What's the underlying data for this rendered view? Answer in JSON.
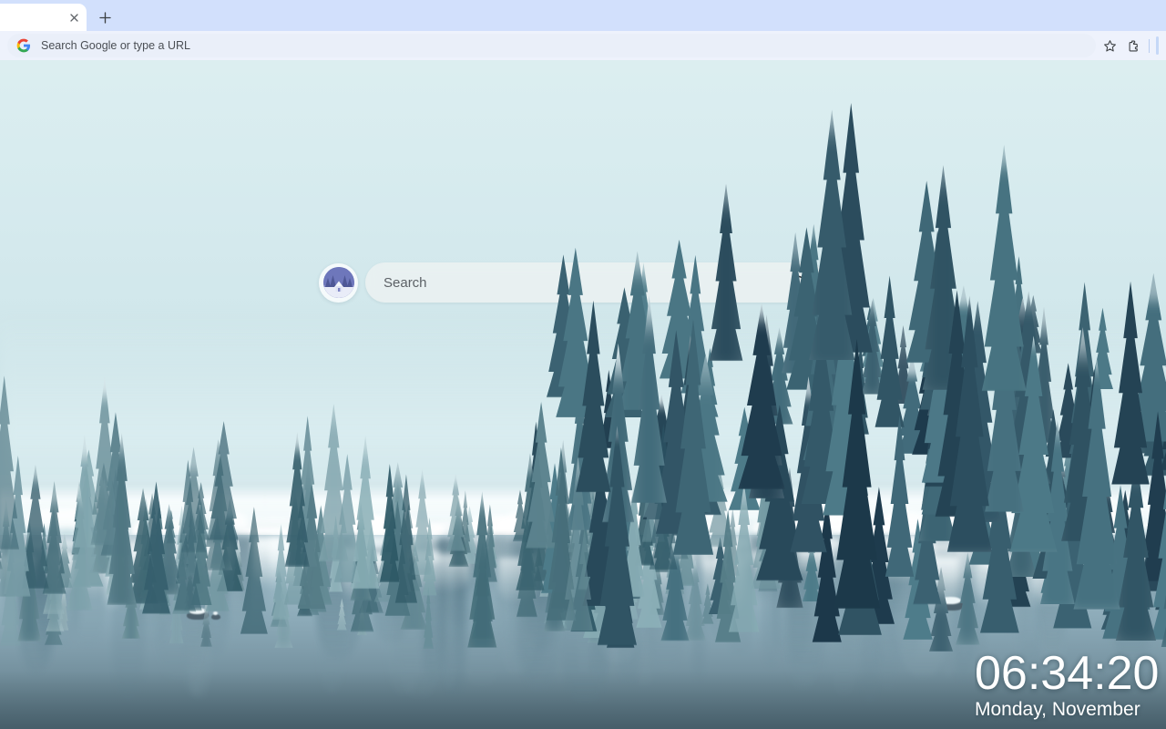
{
  "browser": {
    "tab": {
      "title": "",
      "close_icon": "close-icon",
      "favicon": ""
    },
    "new_tab_label": "+",
    "omnibox": {
      "placeholder": "Search Google or type a URL",
      "value": "",
      "logo_icon": "google-g-icon"
    },
    "toolbar_icons": [
      {
        "name": "bookmark-star-icon",
        "glyph": "☆"
      },
      {
        "name": "extensions-puzzle-icon",
        "glyph": "⚙"
      }
    ]
  },
  "newtab": {
    "search": {
      "placeholder": "Search",
      "value": "",
      "submit_icon": "search-icon",
      "avatar_icon": "winter-cabin-avatar-icon"
    },
    "clock": {
      "time": "06:34:20",
      "date": "Monday, November"
    },
    "wallpaper": {
      "description": "Snow-covered evergreen forest reflected in a misty winter lake",
      "sky_color": "#d8ecef",
      "forest_color": "#2f5560",
      "snow_color": "#f4fbfc",
      "water_color": "#8ba9b7"
    }
  },
  "colors": {
    "tabstrip_bg": "#d2e0fc",
    "toolbar_bg": "#eef2fc",
    "omnibox_bg": "#eaeff9",
    "tab_active_bg": "#ffffff",
    "clock_text": "#ffffff"
  }
}
